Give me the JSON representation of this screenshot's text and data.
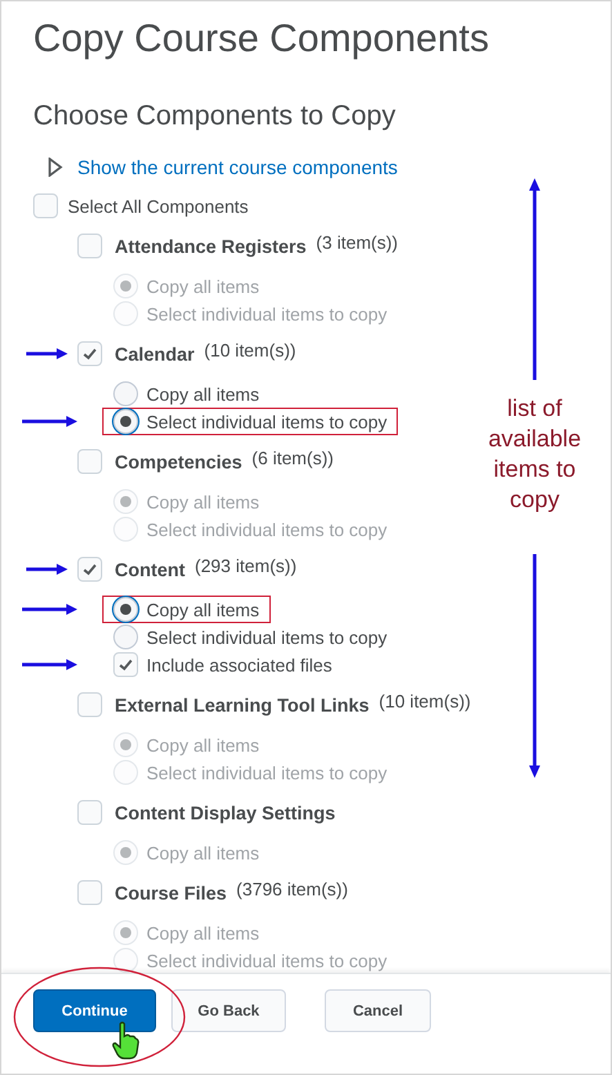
{
  "page": {
    "title": "Copy Course Components",
    "subtitle": "Choose Components to Copy"
  },
  "show_components_link": {
    "label": "Show the current course components",
    "expanded": false
  },
  "select_all": {
    "label": "Select All Components",
    "checked": false
  },
  "components": [
    {
      "name": "Attendance Registers",
      "count": "(3 item(s))",
      "checked": false,
      "arrow": false,
      "options": [
        {
          "kind": "radio",
          "label": "Copy all items",
          "selected": true,
          "disabled": true,
          "boxed": false,
          "arrow": false
        },
        {
          "kind": "radio",
          "label": "Select individual items to copy",
          "selected": false,
          "disabled": true,
          "boxed": false,
          "arrow": false
        }
      ]
    },
    {
      "name": "Calendar",
      "count": "(10 item(s))",
      "checked": true,
      "arrow": true,
      "options": [
        {
          "kind": "radio",
          "label": "Copy all items",
          "selected": false,
          "disabled": false,
          "boxed": false,
          "arrow": false
        },
        {
          "kind": "radio",
          "label": "Select individual items to copy",
          "selected": true,
          "disabled": false,
          "boxed": true,
          "arrow": true
        }
      ]
    },
    {
      "name": "Competencies",
      "count": "(6 item(s))",
      "checked": false,
      "arrow": false,
      "options": [
        {
          "kind": "radio",
          "label": "Copy all items",
          "selected": true,
          "disabled": true,
          "boxed": false,
          "arrow": false
        },
        {
          "kind": "radio",
          "label": "Select individual items to copy",
          "selected": false,
          "disabled": true,
          "boxed": false,
          "arrow": false
        }
      ]
    },
    {
      "name": "Content",
      "count": "(293 item(s))",
      "checked": true,
      "arrow": true,
      "options": [
        {
          "kind": "radio",
          "label": "Copy all items",
          "selected": true,
          "disabled": false,
          "boxed": true,
          "arrow": true
        },
        {
          "kind": "radio",
          "label": "Select individual items to copy",
          "selected": false,
          "disabled": false,
          "boxed": false,
          "arrow": false
        },
        {
          "kind": "checkbox",
          "label": "Include associated files",
          "checked": true,
          "disabled": false,
          "boxed": false,
          "arrow": true
        }
      ]
    },
    {
      "name": "External Learning Tool Links",
      "count": "(10 item(s))",
      "checked": false,
      "arrow": false,
      "options": [
        {
          "kind": "radio",
          "label": "Copy all items",
          "selected": true,
          "disabled": true,
          "boxed": false,
          "arrow": false
        },
        {
          "kind": "radio",
          "label": "Select individual items to copy",
          "selected": false,
          "disabled": true,
          "boxed": false,
          "arrow": false
        }
      ]
    },
    {
      "name": "Content Display Settings",
      "checked": false,
      "arrow": false,
      "options": [
        {
          "kind": "radio",
          "label": "Copy all items",
          "selected": true,
          "disabled": true,
          "boxed": false,
          "arrow": false
        }
      ]
    },
    {
      "name": "Course Files",
      "count": "(3796 item(s))",
      "checked": false,
      "arrow": false,
      "options": [
        {
          "kind": "radio",
          "label": "Copy all items",
          "selected": true,
          "disabled": true,
          "boxed": false,
          "arrow": false
        },
        {
          "kind": "radio",
          "label": "Select individual items to copy",
          "selected": false,
          "disabled": true,
          "boxed": false,
          "arrow": false
        }
      ]
    }
  ],
  "annotation": {
    "text": "list of available items to copy"
  },
  "buttons": [
    {
      "label": "Continue",
      "kind": "primary",
      "circled": true
    },
    {
      "label": "Go Back",
      "kind": "secondary",
      "circled": false
    },
    {
      "label": "Cancel",
      "kind": "secondary",
      "circled": false
    }
  ]
}
